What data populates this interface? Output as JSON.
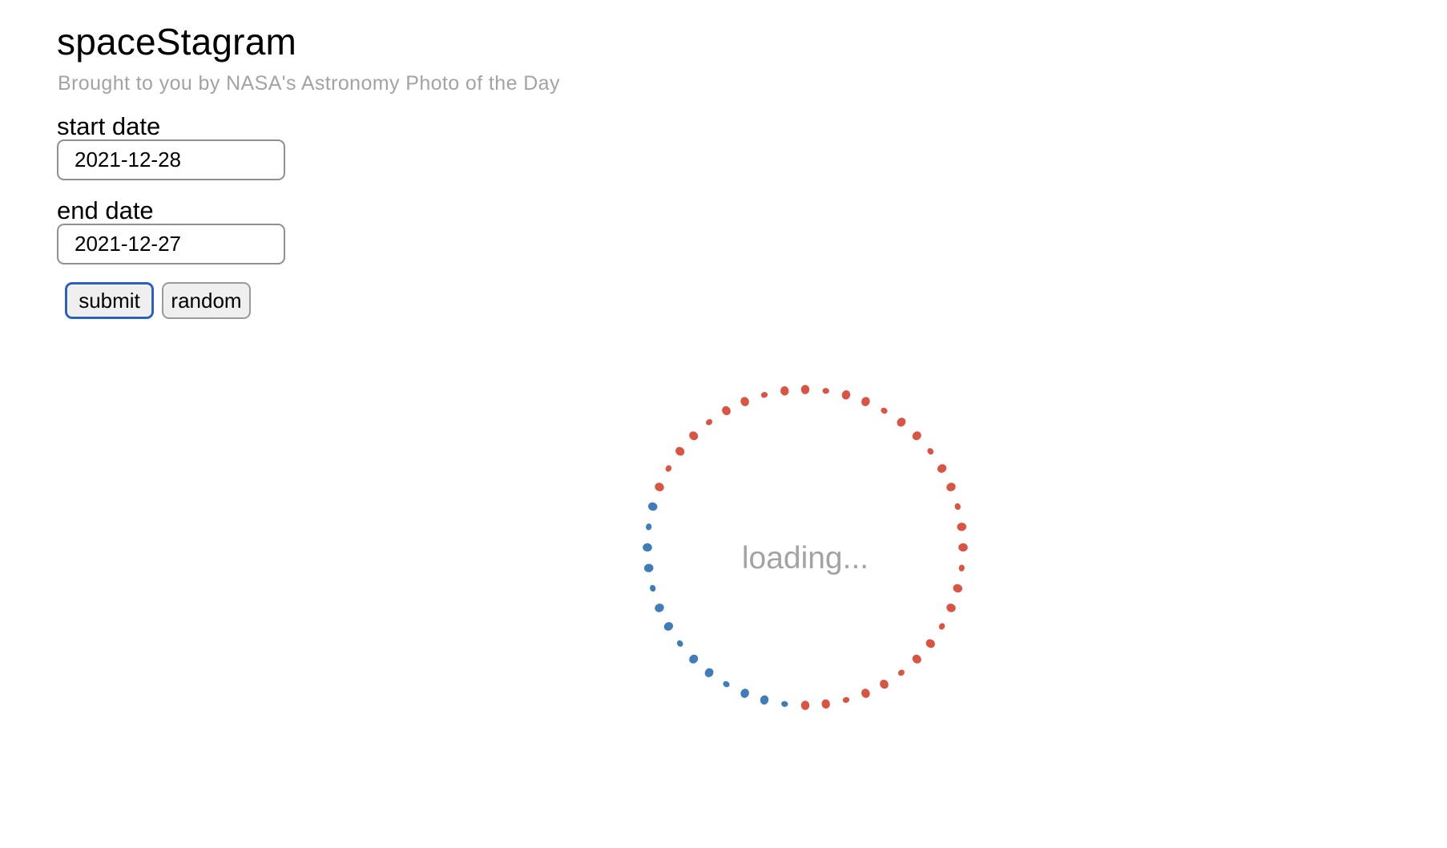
{
  "header": {
    "title": "spaceStagram",
    "subtitle": "Brought to you by NASA's Astronomy Photo of the Day"
  },
  "form": {
    "start_label": "start date",
    "start_value": "2021-12-28",
    "end_label": "end date",
    "end_value": "2021-12-27",
    "submit_label": "submit",
    "random_label": "random"
  },
  "loader": {
    "text": "loading...",
    "colors": {
      "primary": "#d95443",
      "secondary": "#3f7cb8"
    }
  }
}
